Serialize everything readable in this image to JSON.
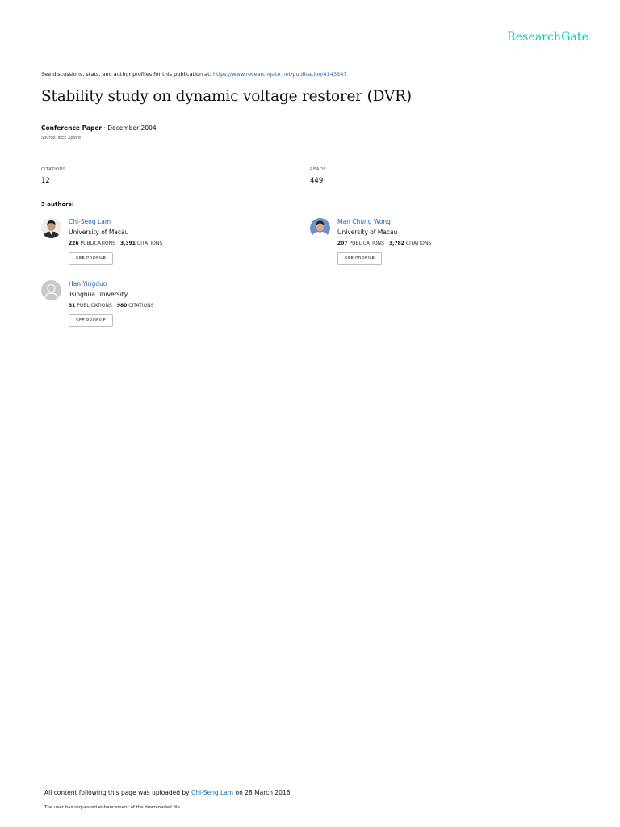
{
  "brand": {
    "logo": "ResearchGate"
  },
  "header": {
    "discuss_text": "See discussions, stats, and author profiles for this publication at: ",
    "discuss_link": "https://www.researchgate.net/publication/4143347"
  },
  "paper": {
    "title": "Stability study on dynamic voltage restorer (DVR)",
    "type": "Conference Paper",
    "date_sep": " · ",
    "date": "December 2004",
    "source": "Source: IEEE Xplore"
  },
  "stats": {
    "citations_label": "CITATIONS",
    "citations_value": "12",
    "reads_label": "READS",
    "reads_value": "449"
  },
  "authors_heading": "3 authors:",
  "authors": [
    {
      "name": "Chi-Seng Lam",
      "institution": "University of Macau",
      "publications": "226",
      "publications_label": "PUBLICATIONS",
      "citations": "3,391",
      "citations_label": "CITATIONS",
      "button": "SEE PROFILE"
    },
    {
      "name": "Man Chung Wong",
      "institution": "University of Macau",
      "publications": "207",
      "publications_label": "PUBLICATIONS",
      "citations": "3,782",
      "citations_label": "CITATIONS",
      "button": "SEE PROFILE"
    },
    {
      "name": "Han Yingduo",
      "institution": "Tsinghua University",
      "publications": "31",
      "publications_label": "PUBLICATIONS",
      "citations": "980",
      "citations_label": "CITATIONS",
      "button": "SEE PROFILE"
    }
  ],
  "footer": {
    "uploaded_prefix": "All content following this page was uploaded by ",
    "uploader": "Chi-Seng Lam",
    "uploaded_suffix": " on 28 March 2016.",
    "note": "The user has requested enhancement of the downloaded file."
  }
}
